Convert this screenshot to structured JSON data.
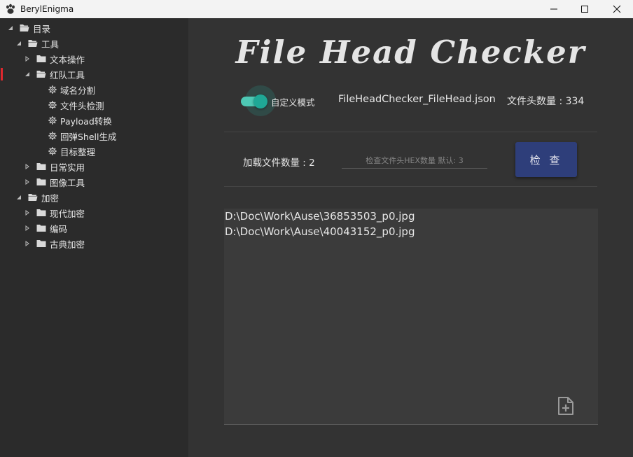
{
  "window": {
    "title": "BerylEnigma",
    "icons": {
      "app": "paw-icon",
      "minimize": "minimize-icon",
      "maximize": "maximize-icon",
      "close": "close-icon"
    }
  },
  "tree": [
    {
      "label": "目录",
      "expanded": true,
      "icon": "folder-icon"
    },
    {
      "label": "工具",
      "expanded": true,
      "icon": "folder-icon"
    },
    {
      "label": "文本操作",
      "expanded": false,
      "icon": "folder-icon"
    },
    {
      "label": "红队工具",
      "expanded": true,
      "icon": "folder-icon",
      "selected": true
    },
    {
      "label": "域名分割",
      "icon": "gear-icon"
    },
    {
      "label": "文件头检测",
      "icon": "gear-icon"
    },
    {
      "label": "Payload转换",
      "icon": "gear-icon"
    },
    {
      "label": "回弹Shell生成",
      "icon": "gear-icon"
    },
    {
      "label": "目标整理",
      "icon": "gear-icon"
    },
    {
      "label": "日常实用",
      "expanded": false,
      "icon": "folder-icon"
    },
    {
      "label": "图像工具",
      "expanded": false,
      "icon": "folder-icon"
    },
    {
      "label": "加密",
      "expanded": true,
      "icon": "folder-icon"
    },
    {
      "label": "现代加密",
      "expanded": false,
      "icon": "folder-icon"
    },
    {
      "label": "编码",
      "expanded": false,
      "icon": "folder-icon"
    },
    {
      "label": "古典加密",
      "expanded": false,
      "icon": "folder-icon"
    }
  ],
  "main": {
    "title": "File Head Checker",
    "custom_mode": {
      "label": "自定义模式",
      "on": true
    },
    "json_file": "FileHeadChecker_FileHead.json",
    "head_count": "文件头数量 : 334",
    "load_count": "加载文件数量 : 2",
    "hex_placeholder": "检查文件头HEX数量 默认: 3",
    "hex_value": "",
    "check_button": "检 查",
    "files": [
      "D:\\Doc\\Work\\Ause\\36853503_p0.jpg",
      "D:\\Doc\\Work\\Ause\\40043152_p0.jpg"
    ],
    "add_file_icon": "file-add-icon"
  },
  "colors": {
    "accent": "#2e3e7a",
    "toggle": "#1fa896",
    "selection_marker": "#e0282e",
    "sidebar_bg": "#2b2b2b",
    "main_bg": "#333333"
  }
}
